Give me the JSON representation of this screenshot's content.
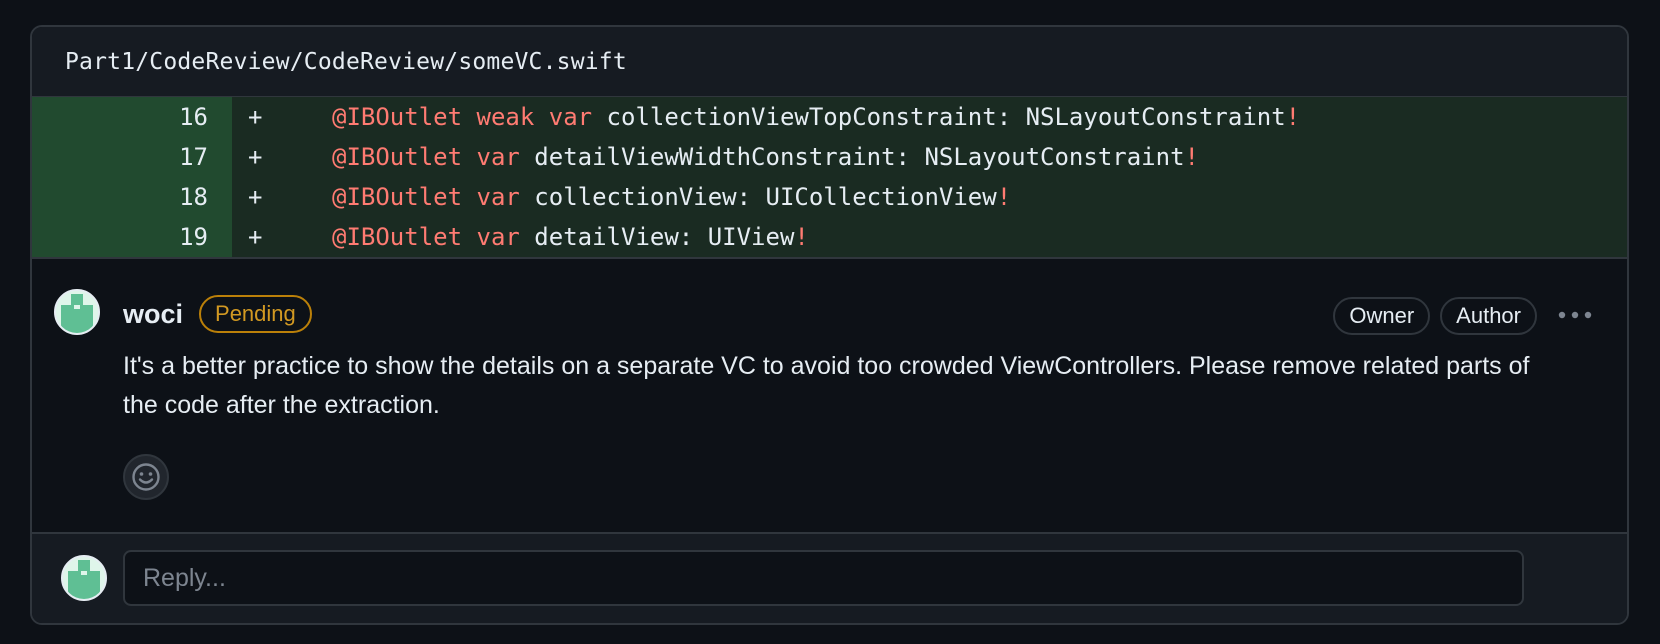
{
  "file": {
    "path": "Part1/CodeReview/CodeReview/someVC.swift"
  },
  "diff": {
    "lines": [
      {
        "number": "16",
        "marker": "+",
        "tokens": [
          {
            "t": "@IBOutlet",
            "k": "kw"
          },
          {
            "t": " ",
            "k": "plain"
          },
          {
            "t": "weak",
            "k": "kw"
          },
          {
            "t": " ",
            "k": "plain"
          },
          {
            "t": "var",
            "k": "kw"
          },
          {
            "t": " collectionViewTopConstraint: NSLayoutConstraint",
            "k": "plain"
          },
          {
            "t": "!",
            "k": "kw"
          }
        ]
      },
      {
        "number": "17",
        "marker": "+",
        "tokens": [
          {
            "t": "@IBOutlet",
            "k": "kw"
          },
          {
            "t": " ",
            "k": "plain"
          },
          {
            "t": "var",
            "k": "kw"
          },
          {
            "t": " detailViewWidthConstraint: NSLayoutConstraint",
            "k": "plain"
          },
          {
            "t": "!",
            "k": "kw"
          }
        ]
      },
      {
        "number": "18",
        "marker": "+",
        "tokens": [
          {
            "t": "@IBOutlet",
            "k": "kw"
          },
          {
            "t": " ",
            "k": "plain"
          },
          {
            "t": "var",
            "k": "kw"
          },
          {
            "t": " collectionView: UICollectionView",
            "k": "plain"
          },
          {
            "t": "!",
            "k": "kw"
          }
        ]
      },
      {
        "number": "19",
        "marker": "+",
        "tokens": [
          {
            "t": "@IBOutlet",
            "k": "kw"
          },
          {
            "t": " ",
            "k": "plain"
          },
          {
            "t": "var",
            "k": "kw"
          },
          {
            "t": " detailView: UIView",
            "k": "plain"
          },
          {
            "t": "!",
            "k": "kw"
          }
        ]
      }
    ]
  },
  "comment": {
    "author": "woci",
    "status_badge": "Pending",
    "roles": [
      "Owner",
      "Author"
    ],
    "body": "It's a better practice to show the details on a separate VC to avoid too crowded ViewControllers. Please remove related parts of the code after the extraction."
  },
  "reply": {
    "placeholder": "Reply..."
  },
  "icons": {
    "avatar": "identicon-avatar",
    "more": "kebab-horizontal-icon",
    "emoji": "smiley-icon"
  },
  "colors": {
    "background": "#0d1117",
    "added_line_bg": "#1a2b22",
    "added_num_bg": "#214a2f",
    "keyword": "#ff7b72",
    "pending": "#d29922",
    "border": "#30363d"
  }
}
